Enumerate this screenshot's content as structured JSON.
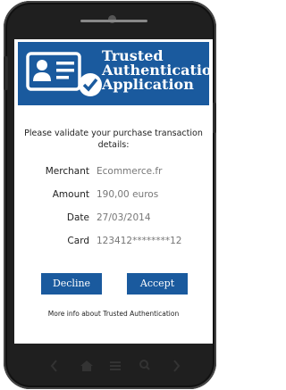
{
  "header": {
    "title_lines": [
      "Trusted",
      "Authentication",
      "Application"
    ],
    "icon": "id-card-check-icon",
    "background": "#1a5a9e"
  },
  "prompt": "Please validate your purchase transaction details:",
  "details": [
    {
      "label": "Merchant",
      "value": "Ecommerce.fr"
    },
    {
      "label": "Amount",
      "value": "190,00 euros"
    },
    {
      "label": "Date",
      "value": "27/03/2014"
    },
    {
      "label": "Card",
      "value": "123412********12"
    }
  ],
  "buttons": {
    "decline": "Decline",
    "accept": "Accept"
  },
  "more_info_link": "More info about Trusted Authentication",
  "nav_icons": [
    "back-icon",
    "home-icon",
    "menu-icon",
    "search-icon",
    "forward-icon"
  ]
}
